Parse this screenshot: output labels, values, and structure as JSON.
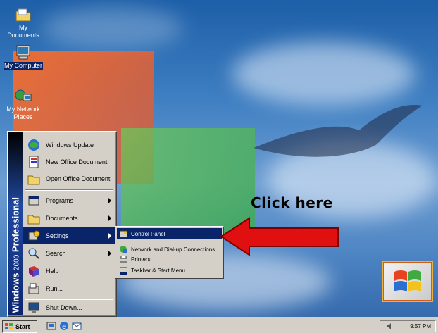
{
  "desktop": {
    "icons": [
      {
        "label": "My Documents",
        "icon": "folder-documents-icon"
      },
      {
        "label": "My Computer",
        "icon": "computer-icon"
      },
      {
        "label": "My Network Places",
        "icon": "network-places-icon"
      }
    ]
  },
  "start_menu": {
    "banner": {
      "brand": "Windows",
      "version": "2000",
      "edition": "Professional"
    },
    "items": [
      {
        "label": "Windows Update",
        "icon": "globe-icon",
        "has_submenu": false
      },
      {
        "label": "New Office Document",
        "icon": "new-document-icon",
        "has_submenu": false
      },
      {
        "label": "Open Office Document",
        "icon": "open-folder-icon",
        "has_submenu": false
      },
      {
        "label": "Programs",
        "icon": "programs-icon",
        "has_submenu": true
      },
      {
        "label": "Documents",
        "icon": "documents-folder-icon",
        "has_submenu": true
      },
      {
        "label": "Settings",
        "icon": "settings-icon",
        "has_submenu": true,
        "highlighted": true
      },
      {
        "label": "Search",
        "icon": "search-icon",
        "has_submenu": true
      },
      {
        "label": "Help",
        "icon": "help-book-icon",
        "has_submenu": false
      },
      {
        "label": "Run...",
        "icon": "run-icon",
        "has_submenu": false
      },
      {
        "label": "Shut Down...",
        "icon": "shutdown-icon",
        "has_submenu": false
      }
    ]
  },
  "settings_submenu": {
    "items": [
      {
        "label": "Control Panel",
        "icon": "control-panel-icon",
        "highlighted": true
      },
      {
        "label": "Network and Dial-up Connections",
        "icon": "network-connections-icon"
      },
      {
        "label": "Printers",
        "icon": "printer-icon"
      },
      {
        "label": "Taskbar & Start Menu...",
        "icon": "taskbar-icon"
      }
    ]
  },
  "annotation": {
    "text": "Click here",
    "arrow_color": "#e01010"
  },
  "taskbar": {
    "start_label": "Start",
    "quick_launch": [
      "show-desktop-icon",
      "internet-explorer-icon",
      "outlook-express-icon"
    ],
    "clock": "9:57 PM"
  },
  "colors": {
    "selection": "#0a246a",
    "menu_face": "#d4d0c8",
    "desktop": "#3f7fc2"
  }
}
